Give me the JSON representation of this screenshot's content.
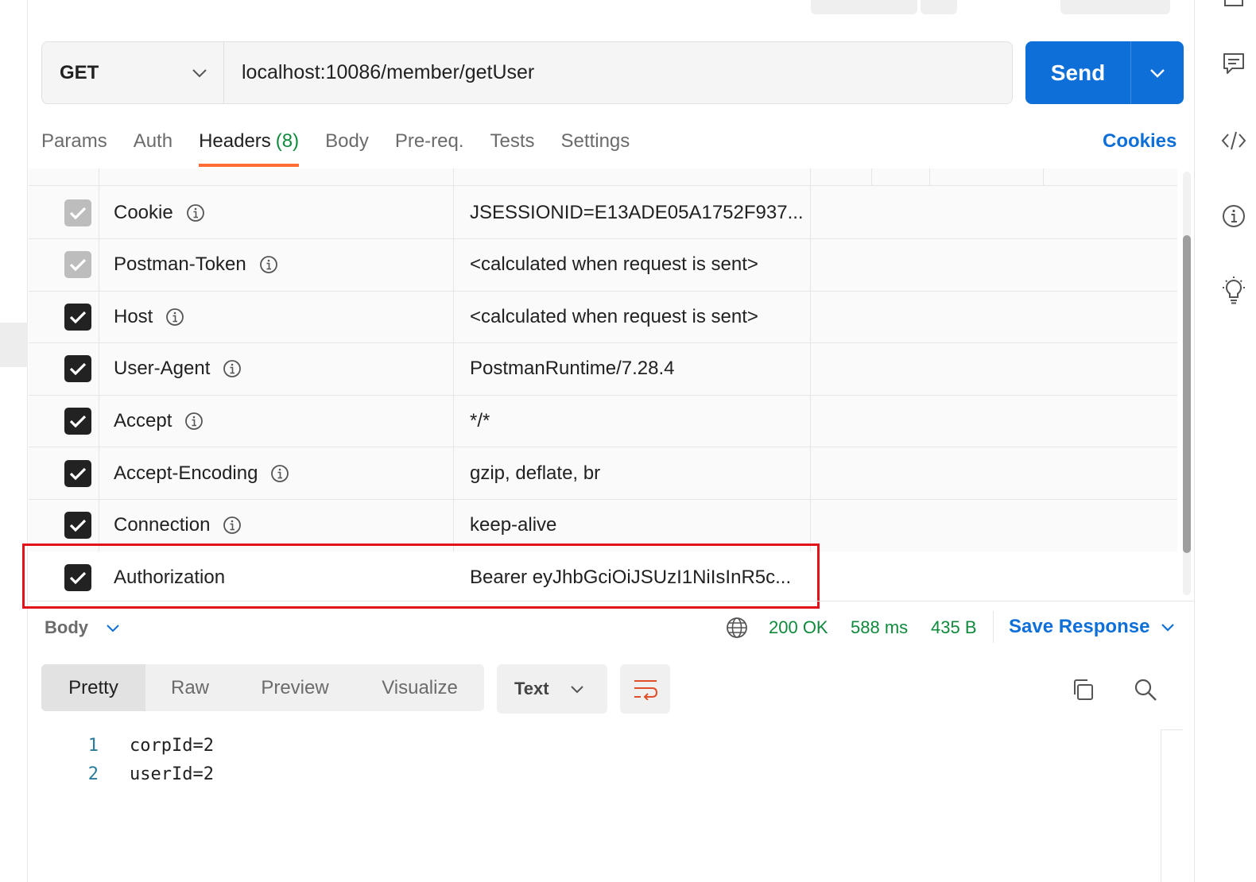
{
  "request": {
    "method": "GET",
    "url": "localhost:10086/member/getUser",
    "send_label": "Send"
  },
  "tabs": [
    {
      "label": "Params"
    },
    {
      "label": "Auth"
    },
    {
      "label": "Headers",
      "count": "(8)"
    },
    {
      "label": "Body"
    },
    {
      "label": "Pre-req."
    },
    {
      "label": "Tests"
    },
    {
      "label": "Settings"
    }
  ],
  "cookies_label": "Cookies",
  "headers": [
    {
      "key": "Cookie",
      "value": "JSESSIONID=E13ADE05A1752F937...",
      "checked": true,
      "disabled": true,
      "info": true
    },
    {
      "key": "Postman-Token",
      "value": "<calculated when request is sent>",
      "checked": true,
      "disabled": true,
      "info": true
    },
    {
      "key": "Host",
      "value": "<calculated when request is sent>",
      "checked": true,
      "disabled": false,
      "info": true
    },
    {
      "key": "User-Agent",
      "value": "PostmanRuntime/7.28.4",
      "checked": true,
      "disabled": false,
      "info": true
    },
    {
      "key": "Accept",
      "value": "*/*",
      "checked": true,
      "disabled": false,
      "info": true
    },
    {
      "key": "Accept-Encoding",
      "value": "gzip, deflate, br",
      "checked": true,
      "disabled": false,
      "info": true
    },
    {
      "key": "Connection",
      "value": "keep-alive",
      "checked": true,
      "disabled": false,
      "info": true
    },
    {
      "key": "Authorization",
      "value": "Bearer eyJhbGciOiJSUzI1NiIsInR5c...",
      "checked": true,
      "disabled": false,
      "info": false
    }
  ],
  "response": {
    "body_label": "Body",
    "status": "200 OK",
    "time": "588 ms",
    "size": "435 B",
    "save_label": "Save Response",
    "views": [
      "Pretty",
      "Raw",
      "Preview",
      "Visualize"
    ],
    "format": "Text",
    "lines": [
      {
        "n": "1",
        "text": "corpId=2"
      },
      {
        "n": "2",
        "text": "userId=2"
      }
    ]
  },
  "colors": {
    "accent": "#0e6fd8",
    "tab_underline": "#ff6c37",
    "status_green": "#0f8a3c",
    "highlight_red": "#e3111a"
  }
}
